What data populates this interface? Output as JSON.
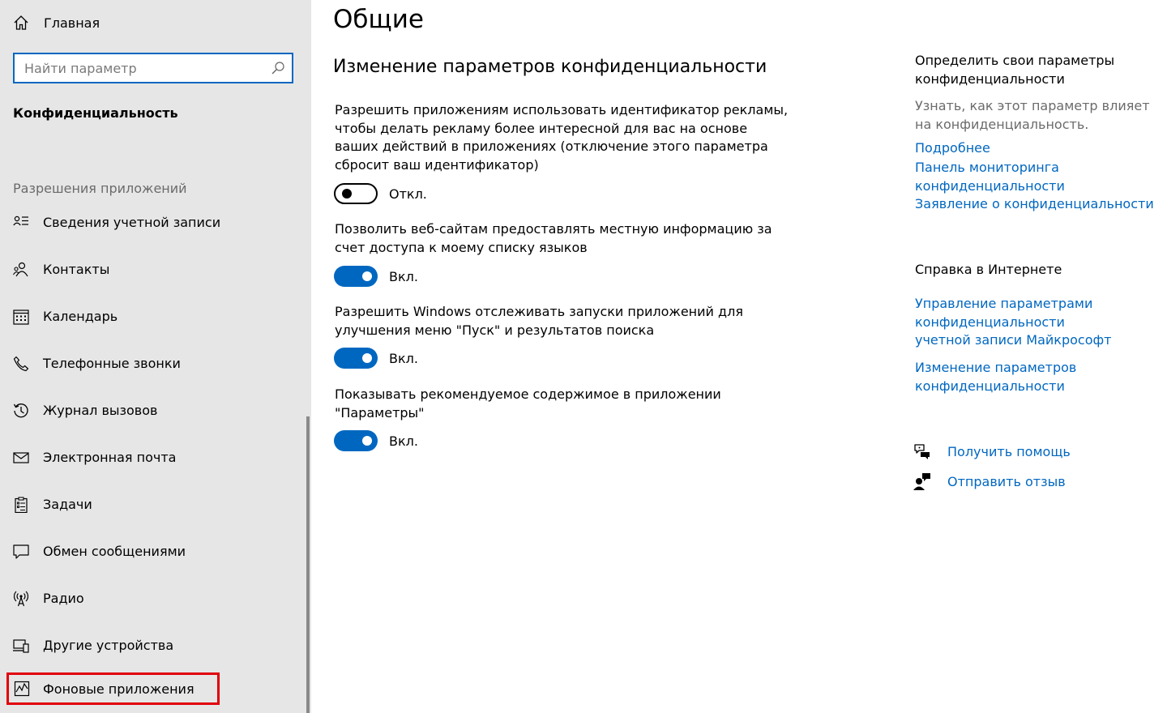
{
  "sidebar": {
    "home_label": "Главная",
    "search_placeholder": "Найти параметр",
    "section_title": "Конфиденциальность",
    "group_title": "Разрешения приложений",
    "items": [
      {
        "label": "Сведения учетной записи",
        "icon": "account-info-icon"
      },
      {
        "label": "Контакты",
        "icon": "contacts-icon"
      },
      {
        "label": "Календарь",
        "icon": "calendar-icon"
      },
      {
        "label": "Телефонные звонки",
        "icon": "phone-icon"
      },
      {
        "label": "Журнал вызовов",
        "icon": "call-history-icon"
      },
      {
        "label": "Электронная почта",
        "icon": "mail-icon"
      },
      {
        "label": "Задачи",
        "icon": "tasks-icon"
      },
      {
        "label": "Обмен сообщениями",
        "icon": "messaging-icon"
      },
      {
        "label": "Радио",
        "icon": "radio-icon"
      },
      {
        "label": "Другие устройства",
        "icon": "devices-icon"
      },
      {
        "label": "Фоновые приложения",
        "icon": "background-apps-icon"
      }
    ]
  },
  "main": {
    "title": "Общие",
    "subheading": "Изменение параметров конфиденциальности",
    "settings": [
      {
        "description": "Разрешить приложениям использовать идентификатор рекламы, чтобы делать рекламу более интересной для вас на основе ваших действий в приложениях (отключение этого параметра сбросит ваш идентификатор)",
        "state": "Откл.",
        "on": false
      },
      {
        "description": "Позволить веб-сайтам предоставлять местную информацию за счет доступа к моему списку языков",
        "state": "Вкл.",
        "on": true
      },
      {
        "description": "Разрешить Windows отслеживать запуски приложений для улучшения меню \"Пуск\" и результатов поиска",
        "state": "Вкл.",
        "on": true
      },
      {
        "description": "Показывать рекомендуемое содержимое в приложении \"Параметры\"",
        "state": "Вкл.",
        "on": true
      }
    ]
  },
  "right": {
    "know_title": "Определить свои параметры конфиденциальности",
    "know_desc": "Узнать, как этот параметр влияет на конфиденциальность.",
    "links": [
      "Подробнее",
      "Панель мониторинга конфиденциальности",
      "Заявление о конфиденциальности"
    ],
    "help_title": "Справка в Интернете",
    "help_links": [
      "Управление параметрами конфиденциальности учетной записи Майкрософт",
      "Изменение параметров конфиденциальности"
    ],
    "get_help": "Получить помощь",
    "send_feedback": "Отправить отзыв"
  },
  "colors": {
    "accent": "#0067c0",
    "sidebar_bg": "#e6e6e6",
    "highlight_border": "#e0000d"
  }
}
